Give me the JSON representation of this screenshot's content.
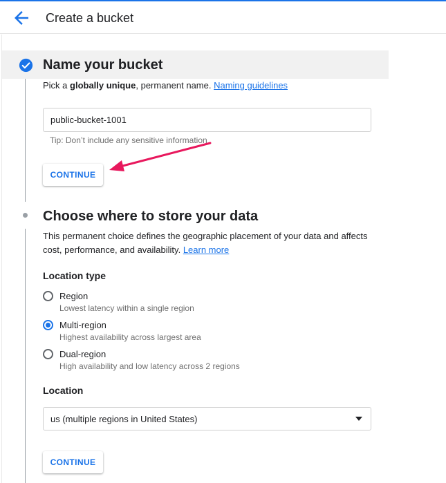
{
  "header": {
    "back_icon": "arrow-back-icon",
    "title": "Create a bucket"
  },
  "colors": {
    "accent": "#1a73e8",
    "annotation_arrow": "#e8185d",
    "step_bar_bg": "#f1f1f1"
  },
  "step1": {
    "status_icon": "check-circle-icon",
    "title": "Name your bucket",
    "desc_prefix": "Pick a ",
    "desc_bold": "globally unique",
    "desc_suffix": ", permanent name. ",
    "naming_link": "Naming guidelines",
    "bucket_name_value": "public-bucket-1001",
    "hint": "Tip: Don’t include any sensitive information",
    "continue_label": "CONTINUE"
  },
  "step2": {
    "title": "Choose where to store your data",
    "desc": "This permanent choice defines the geographic placement of your data and affects cost, performance, and availability. ",
    "learn_more": "Learn more",
    "location_type_label": "Location type",
    "options": [
      {
        "label": "Region",
        "sub": "Lowest latency within a single region",
        "selected": false
      },
      {
        "label": "Multi-region",
        "sub": "Highest availability across largest area",
        "selected": true
      },
      {
        "label": "Dual-region",
        "sub": "High availability and low latency across 2 regions",
        "selected": false
      }
    ],
    "location_label": "Location",
    "location_value": "us (multiple regions in United States)",
    "continue_label": "CONTINUE"
  }
}
